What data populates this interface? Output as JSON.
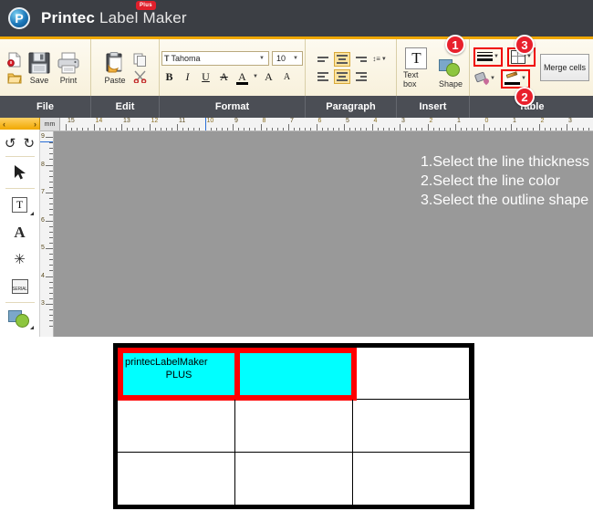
{
  "window": {
    "app_title_brand": "Printec",
    "app_title_rest": " Label Maker",
    "plus_badge": "Plus",
    "logo_letter": "P"
  },
  "ribbon": {
    "groups": [
      {
        "name": "file",
        "label": "File"
      },
      {
        "name": "edit",
        "label": "Edit"
      },
      {
        "name": "format",
        "label": "Format"
      },
      {
        "name": "paragraph",
        "label": "Paragraph"
      },
      {
        "name": "insert",
        "label": "Insert"
      },
      {
        "name": "table",
        "label": "Table"
      }
    ],
    "file": {
      "new_icon": "new-document-icon",
      "open_icon": "open-folder-icon",
      "save_label": "Save",
      "print_label": "Print"
    },
    "edit": {
      "paste_label": "Paste",
      "copy_icon": "copy-icon",
      "cut_icon": "scissors-icon"
    },
    "format": {
      "font_name": "Tahoma",
      "font_size": "10",
      "bold": "B",
      "italic": "I",
      "underline": "U",
      "strikethrough": "A",
      "font_color": "A",
      "grow_font": "A",
      "shrink_font": "A"
    },
    "paragraph": {
      "line_spacing_icon": "line-spacing-icon"
    },
    "insert": {
      "textbox_label": "Text box",
      "shape_label": "Shape"
    },
    "table": {
      "line_thickness_icon": "line-thickness-icon",
      "outline_shape_icon": "table-borders-icon",
      "fill_color_icon": "fill-color-icon",
      "line_color_icon": "line-color-pen-icon",
      "merge_cells_label": "Merge cells"
    }
  },
  "left_palette": {
    "nav_prev": "‹",
    "nav_next": "›",
    "items": [
      {
        "name": "undo-icon",
        "glyph": "↺"
      },
      {
        "name": "redo-icon",
        "glyph": "↻"
      },
      {
        "name": "select-arrow-icon",
        "glyph": "➤"
      },
      {
        "name": "text-box-icon",
        "glyph": "T"
      },
      {
        "name": "word-art-icon",
        "glyph": "A"
      },
      {
        "name": "symbol-icon",
        "glyph": "✳"
      },
      {
        "name": "serial-icon",
        "glyph": "SERIAL"
      },
      {
        "name": "shape-icon",
        "glyph": "●"
      }
    ]
  },
  "editor": {
    "unit_label": "mm",
    "h_ruler_numbers": [
      "15",
      "14",
      "13",
      "12",
      "11",
      "10",
      "9",
      "8",
      "7",
      "6",
      "5",
      "4",
      "3",
      "2",
      "1",
      "0",
      "1",
      "2",
      "3"
    ],
    "v_ruler_numbers": [
      "9",
      "8",
      "7",
      "6",
      "5",
      "4",
      "3"
    ],
    "instructions": [
      "1.Select the line thickness",
      "2.Select the line color",
      "3.Select the outline shape"
    ],
    "canvas_color": "#999999"
  },
  "label_table": {
    "rows": 3,
    "columns": 3,
    "selection": {
      "border_color": "#ff0000",
      "fill_color": "#00ffff",
      "cell_text_line1": "printecLabelMaker",
      "cell_text_line2": "PLUS"
    }
  },
  "callouts": [
    {
      "id": "1",
      "target": "line-thickness-button"
    },
    {
      "id": "2",
      "target": "line-color-button"
    },
    {
      "id": "3",
      "target": "outline-shape-button"
    }
  ]
}
